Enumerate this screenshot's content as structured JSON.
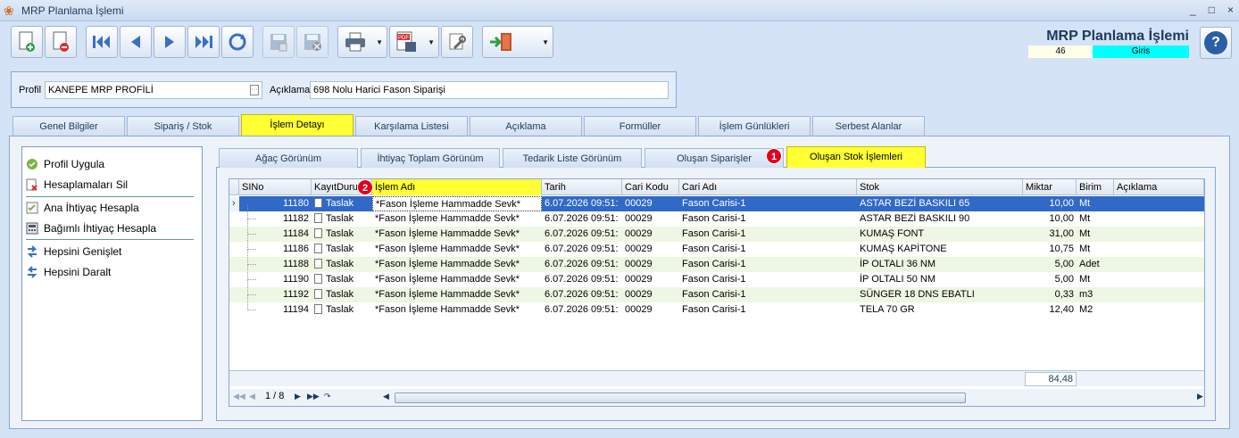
{
  "window": {
    "title": "MRP Planlama İşlemi",
    "controls": [
      "_",
      "□",
      "×"
    ]
  },
  "header": {
    "title": "MRP Planlama İşlemi",
    "record_number": "46",
    "status": "Giris"
  },
  "toolbar": {
    "pdf_label": "PDF"
  },
  "profile": {
    "profile_label": "Profil",
    "profile_value": "KANEPE MRP PROFİLİ",
    "description_label": "Açıklama",
    "description_value": "698 Nolu Harici Fason Siparişi"
  },
  "tabs": [
    {
      "label": "Genel Bilgiler"
    },
    {
      "label": "Sipariş / Stok"
    },
    {
      "label": "İşlem Detayı"
    },
    {
      "label": "Karşılama Listesi"
    },
    {
      "label": "Açıklama"
    },
    {
      "label": "Formüller"
    },
    {
      "label": "İşlem Günlükleri"
    },
    {
      "label": "Serbest Alanlar"
    }
  ],
  "actions": [
    {
      "label": "Profil Uygula"
    },
    {
      "label": "Hesaplamaları Sil"
    },
    {
      "label": "Ana İhtiyaç Hesapla"
    },
    {
      "label": "Bağımlı İhtiyaç Hesapla"
    },
    {
      "label": "Hepsini Genişlet"
    },
    {
      "label": "Hepsini Daralt"
    }
  ],
  "subtabs": [
    {
      "label": "Ağaç Görünüm"
    },
    {
      "label": "İhtiyaç Toplam Görünüm"
    },
    {
      "label": "Tedarik Liste Görünüm"
    },
    {
      "label": "Oluşan Siparişler"
    },
    {
      "label": "Oluşan Stok İşlemleri"
    }
  ],
  "badges": {
    "one": "1",
    "two": "2"
  },
  "grid": {
    "columns": [
      "SINo",
      "KayıtDurumu",
      "İşlem Adı",
      "Tarih",
      "Cari Kodu",
      "Cari Adı",
      "Stok",
      "Miktar",
      "Birim",
      "Açıklama"
    ],
    "rows": [
      {
        "sino": "11180",
        "durum": "Taslak",
        "islem": "*Fason İşleme Hammadde Sevk*",
        "tarih": "6.07.2026 09:51:",
        "cari_kodu": "00029",
        "cari_adi": "Fason Carisi-1",
        "stok": "ASTAR BEZİ BASKILI 65",
        "miktar": "10,00",
        "birim": "Mt"
      },
      {
        "sino": "11182",
        "durum": "Taslak",
        "islem": "*Fason İşleme Hammadde Sevk*",
        "tarih": "6.07.2026 09:51:",
        "cari_kodu": "00029",
        "cari_adi": "Fason Carisi-1",
        "stok": "ASTAR BEZİ BASKILI 90",
        "miktar": "10,00",
        "birim": "Mt"
      },
      {
        "sino": "11184",
        "durum": "Taslak",
        "islem": "*Fason İşleme Hammadde Sevk*",
        "tarih": "6.07.2026 09:51:",
        "cari_kodu": "00029",
        "cari_adi": "Fason Carisi-1",
        "stok": "KUMAŞ FONT",
        "miktar": "31,00",
        "birim": "Mt"
      },
      {
        "sino": "11186",
        "durum": "Taslak",
        "islem": "*Fason İşleme Hammadde Sevk*",
        "tarih": "6.07.2026 09:51:",
        "cari_kodu": "00029",
        "cari_adi": "Fason Carisi-1",
        "stok": "KUMAŞ KAPİTONE",
        "miktar": "10,75",
        "birim": "Mt"
      },
      {
        "sino": "11188",
        "durum": "Taslak",
        "islem": "*Fason İşleme Hammadde Sevk*",
        "tarih": "6.07.2026 09:51:",
        "cari_kodu": "00029",
        "cari_adi": "Fason Carisi-1",
        "stok": "İP OLTALI 36 NM",
        "miktar": "5,00",
        "birim": "Adet"
      },
      {
        "sino": "11190",
        "durum": "Taslak",
        "islem": "*Fason İşleme Hammadde Sevk*",
        "tarih": "6.07.2026 09:51:",
        "cari_kodu": "00029",
        "cari_adi": "Fason Carisi-1",
        "stok": "İP OLTALI 50 NM",
        "miktar": "5,00",
        "birim": "Mt"
      },
      {
        "sino": "11192",
        "durum": "Taslak",
        "islem": "*Fason İşleme Hammadde Sevk*",
        "tarih": "6.07.2026 09:51:",
        "cari_kodu": "00029",
        "cari_adi": "Fason Carisi-1",
        "stok": "SÜNGER 18 DNS EBATLI",
        "miktar": "0,33",
        "birim": "m3"
      },
      {
        "sino": "11194",
        "durum": "Taslak",
        "islem": "*Fason İşleme Hammadde Sevk*",
        "tarih": "6.07.2026 09:51:",
        "cari_kodu": "00029",
        "cari_adi": "Fason Carisi-1",
        "stok": "TELA 70 GR",
        "miktar": "12,40",
        "birim": "M2"
      }
    ],
    "total_miktar": "84,48",
    "pager": "1 / 8"
  },
  "colors": {
    "accent_yellow": "#ffff33",
    "selection_blue": "#3169c6",
    "status_cyan": "#00ffff",
    "badge_red": "#e3001b"
  }
}
